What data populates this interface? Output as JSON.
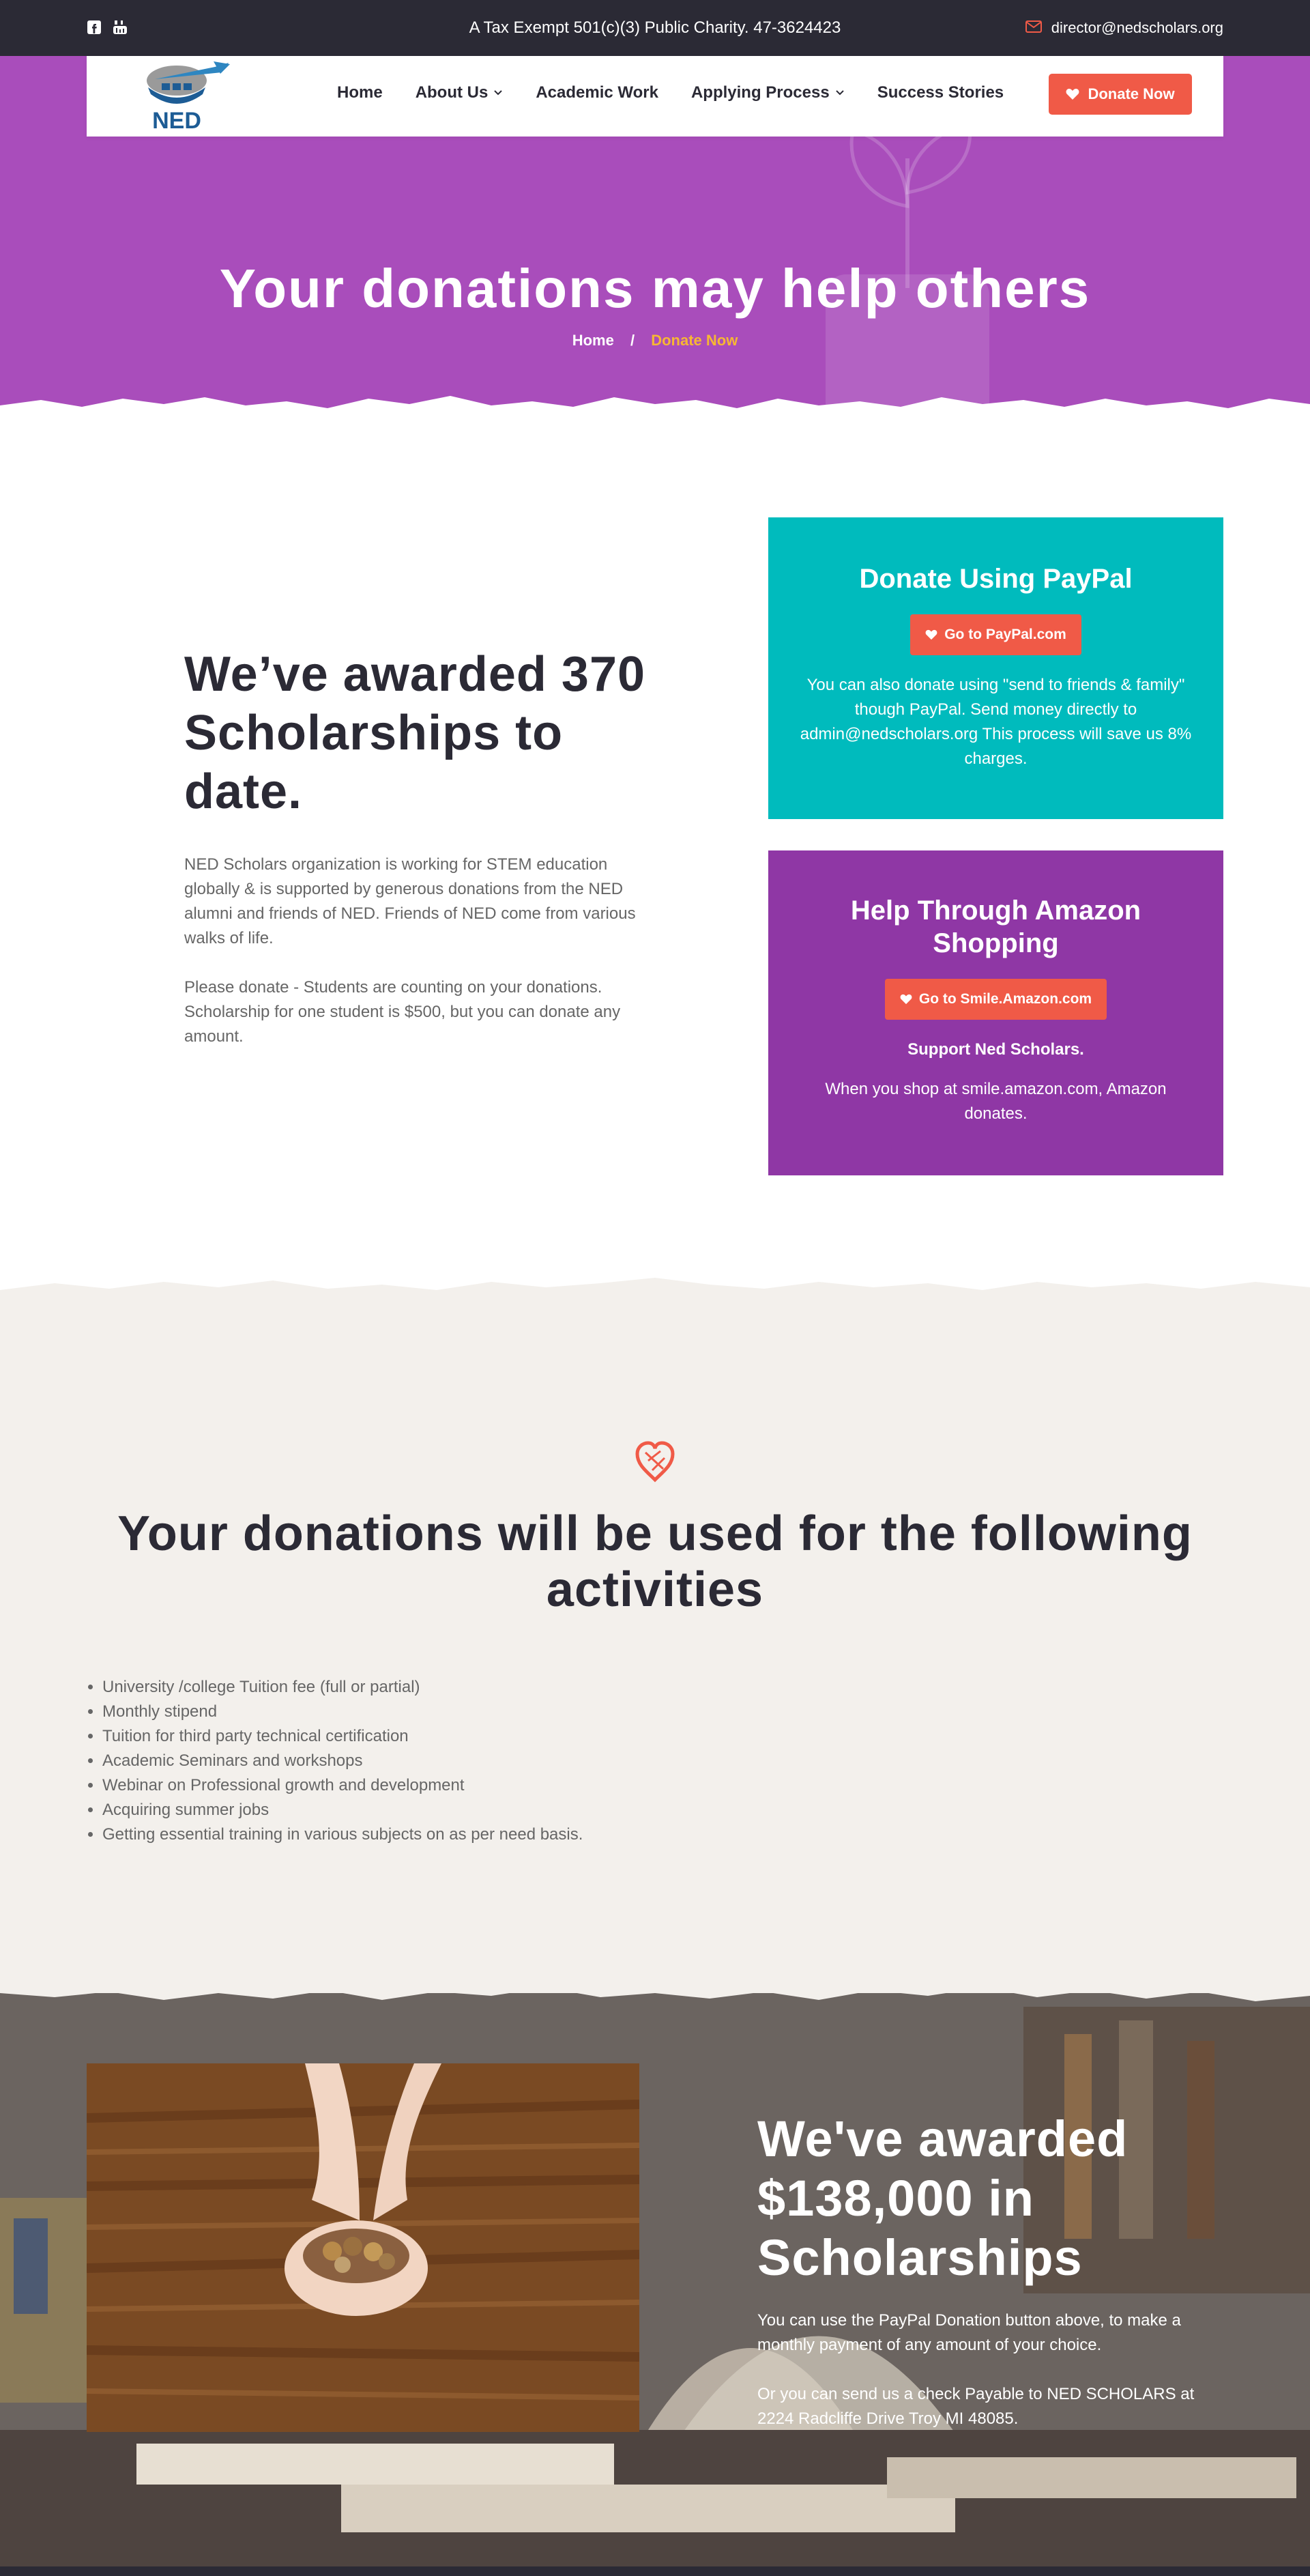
{
  "topbar": {
    "tagline": "A Tax Exempt 501(c)(3) Public Charity. 47-3624423",
    "email": "director@nedscholars.org",
    "social": [
      "facebook-icon",
      "youtube-icon"
    ],
    "mail_icon": "envelope-icon"
  },
  "nav": {
    "logo_text": "NED",
    "items": [
      {
        "label": "Home",
        "dropdown": false
      },
      {
        "label": "About Us",
        "dropdown": true
      },
      {
        "label": "Academic Work",
        "dropdown": false
      },
      {
        "label": "Applying Process",
        "dropdown": true
      },
      {
        "label": "Success Stories",
        "dropdown": false
      }
    ],
    "donate_label": "Donate Now"
  },
  "hero": {
    "title": "Your donations may help others",
    "breadcrumb": {
      "home": "Home",
      "separator": "/",
      "current": "Donate Now"
    }
  },
  "about": {
    "heading": "We’ve awarded 370 Scholarships to date.",
    "para1": "NED Scholars organization is working for STEM education globally & is supported by generous donations from the NED alumni and friends of NED. Friends of NED come from various walks of life.",
    "para2": "Please donate - Students are counting on your donations. Scholarship for one student is $500, but you can donate any amount."
  },
  "paypal": {
    "title": "Donate Using PayPal",
    "button": "Go to PayPal.com",
    "text": "You can also donate using \"send to friends & family\" though PayPal. Send money directly to admin@nedscholars.org This process will save us 8% charges."
  },
  "amazon": {
    "title": "Help Through Amazon Shopping",
    "button": "Go to Smile.Amazon.com",
    "strong": "Support Ned Scholars.",
    "text": "When you shop at smile.amazon.com, Amazon donates."
  },
  "activities": {
    "heading": "Your donations will be used for the following activities",
    "items": [
      "University /college Tuition fee (full or partial)",
      "Monthly stipend",
      "Tuition for third party technical certification",
      "Academic Seminars and workshops",
      "Webinar on Professional growth and development",
      "Acquiring summer jobs",
      "Getting essential training in various subjects on as per need basis."
    ]
  },
  "funds": {
    "heading": "We've awarded $138,000 in Scholarships",
    "para1": "You can use the PayPal Donation button above, to make a monthly payment of any amount of your choice.",
    "para2": "Or you can send us a check Payable to NED SCHOLARS at 2224 Radcliffe Drive Troy MI 48085."
  },
  "colors": {
    "dark": "#2b2a35",
    "accent": "#f05a47",
    "hero_purple": "#a94dbb",
    "paypal_teal": "#00bbbd",
    "amazon_purple": "#8f37a5",
    "breadcrumb_current": "#f7b733",
    "section_bg": "#f3f0ec"
  }
}
